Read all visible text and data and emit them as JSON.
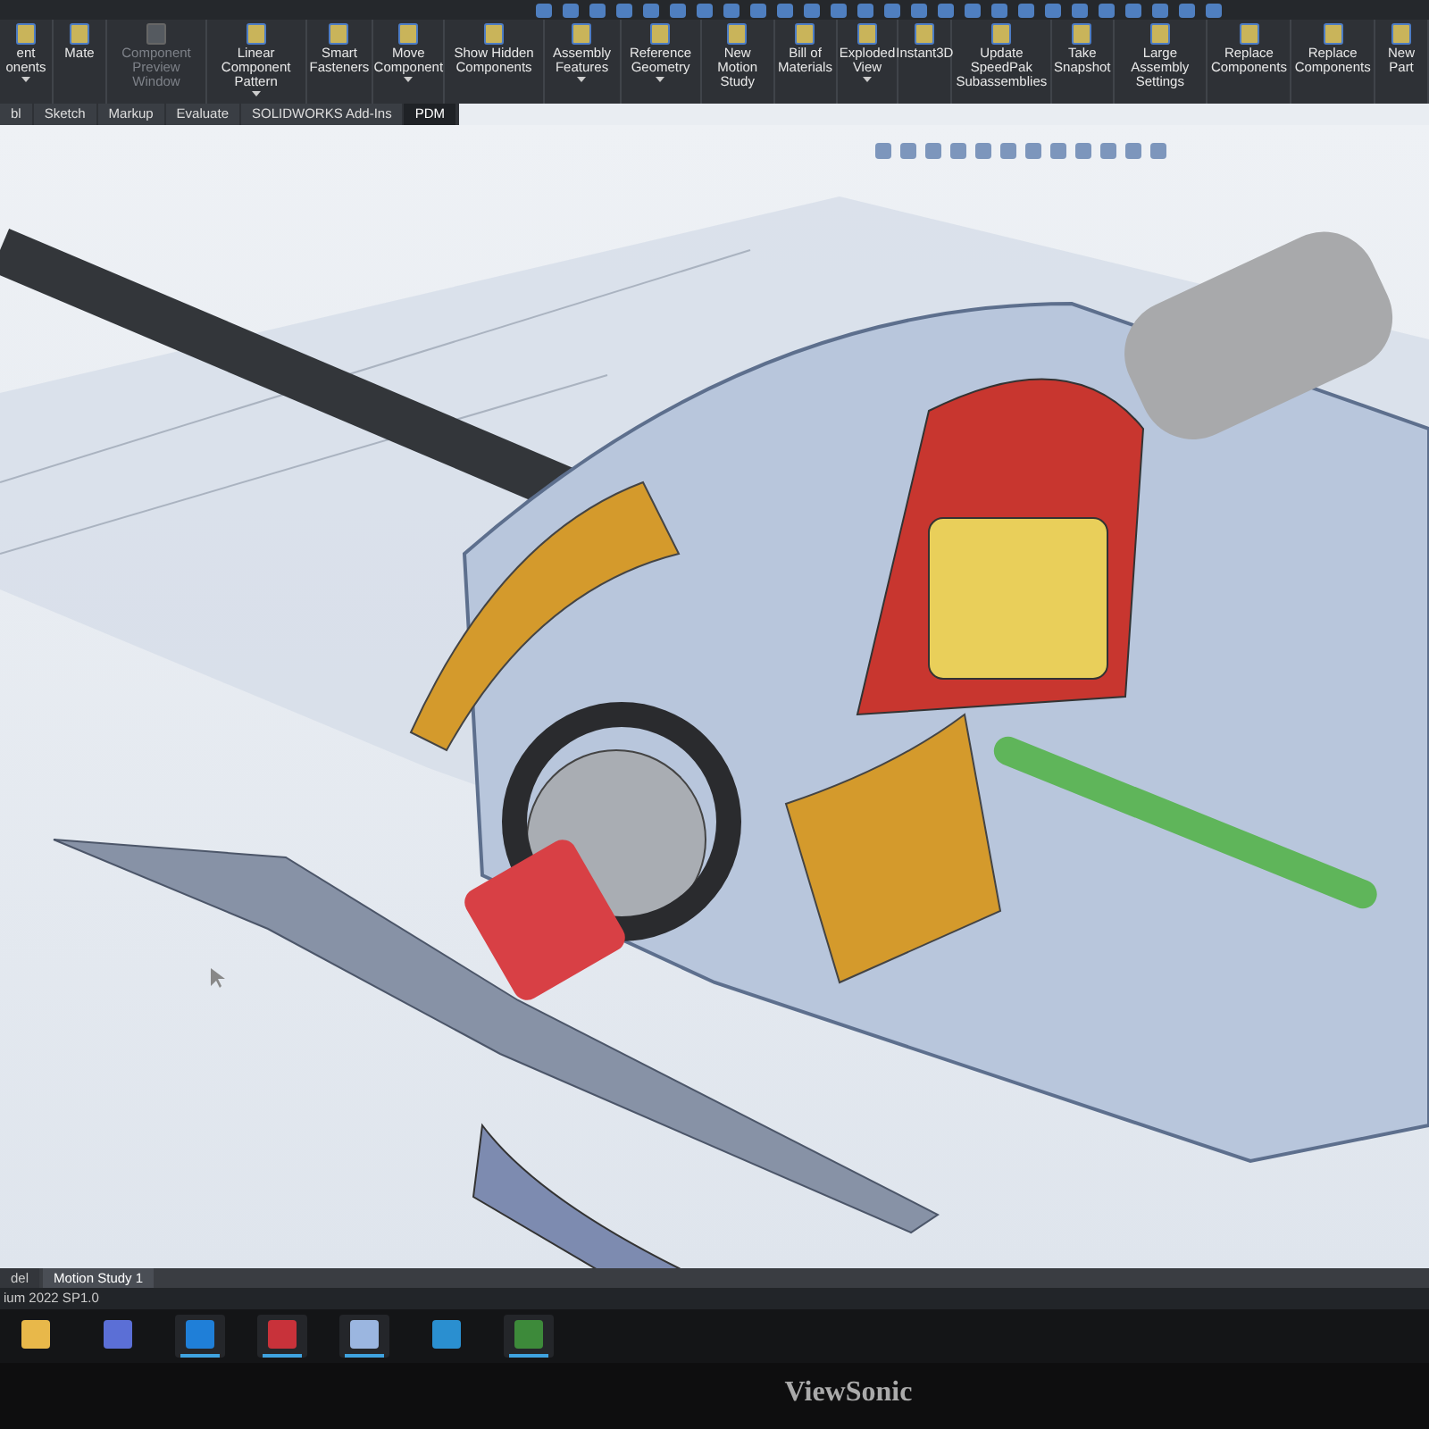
{
  "ribbon": {
    "items": [
      {
        "label": "ent onents",
        "disabled": false,
        "has_menu": true
      },
      {
        "label": "Mate",
        "disabled": false,
        "has_menu": false
      },
      {
        "label": "Component Preview Window",
        "disabled": true,
        "has_menu": false
      },
      {
        "label": "Linear Component Pattern",
        "disabled": false,
        "has_menu": true
      },
      {
        "label": "Smart Fasteners",
        "disabled": false,
        "has_menu": false
      },
      {
        "label": "Move Component",
        "disabled": false,
        "has_menu": true
      },
      {
        "label": "Show Hidden Components",
        "disabled": false,
        "has_menu": false
      },
      {
        "label": "Assembly Features",
        "disabled": false,
        "has_menu": true
      },
      {
        "label": "Reference Geometry",
        "disabled": false,
        "has_menu": true
      },
      {
        "label": "New Motion Study",
        "disabled": false,
        "has_menu": false
      },
      {
        "label": "Bill of Materials",
        "disabled": false,
        "has_menu": false
      },
      {
        "label": "Exploded View",
        "disabled": false,
        "has_menu": true
      },
      {
        "label": "Instant3D",
        "disabled": false,
        "has_menu": false
      },
      {
        "label": "Update SpeedPak Subassemblies",
        "disabled": false,
        "has_menu": false
      },
      {
        "label": "Take Snapshot",
        "disabled": false,
        "has_menu": false
      },
      {
        "label": "Large Assembly Settings",
        "disabled": false,
        "has_menu": false
      },
      {
        "label": "Replace Components",
        "disabled": false,
        "has_menu": false
      },
      {
        "label": "Replace Components",
        "disabled": false,
        "has_menu": false
      },
      {
        "label": "New Part",
        "disabled": false,
        "has_menu": false
      }
    ]
  },
  "tabs": [
    {
      "label": "bl",
      "selected": false
    },
    {
      "label": "Sketch",
      "selected": false
    },
    {
      "label": "Markup",
      "selected": false
    },
    {
      "label": "Evaluate",
      "selected": false
    },
    {
      "label": "SOLIDWORKS Add-Ins",
      "selected": false
    },
    {
      "label": "PDM",
      "selected": true
    }
  ],
  "bottom_tabs": [
    {
      "label": "del",
      "selected": false
    },
    {
      "label": "Motion Study 1",
      "selected": true
    }
  ],
  "status_bar": {
    "text": "ium 2022 SP1.0"
  },
  "taskbar": {
    "apps": [
      {
        "color": "#e8b84a",
        "active": false
      },
      {
        "color": "#5b6fd6",
        "active": false
      },
      {
        "color": "#1f7fd8",
        "active": true
      },
      {
        "color": "#c8323a",
        "active": true
      },
      {
        "color": "#9bb6e0",
        "active": true
      },
      {
        "color": "#2a8fd0",
        "active": false
      },
      {
        "color": "#3d8a3a",
        "active": true
      }
    ]
  },
  "monitor": {
    "brand": "ViewSonic"
  }
}
